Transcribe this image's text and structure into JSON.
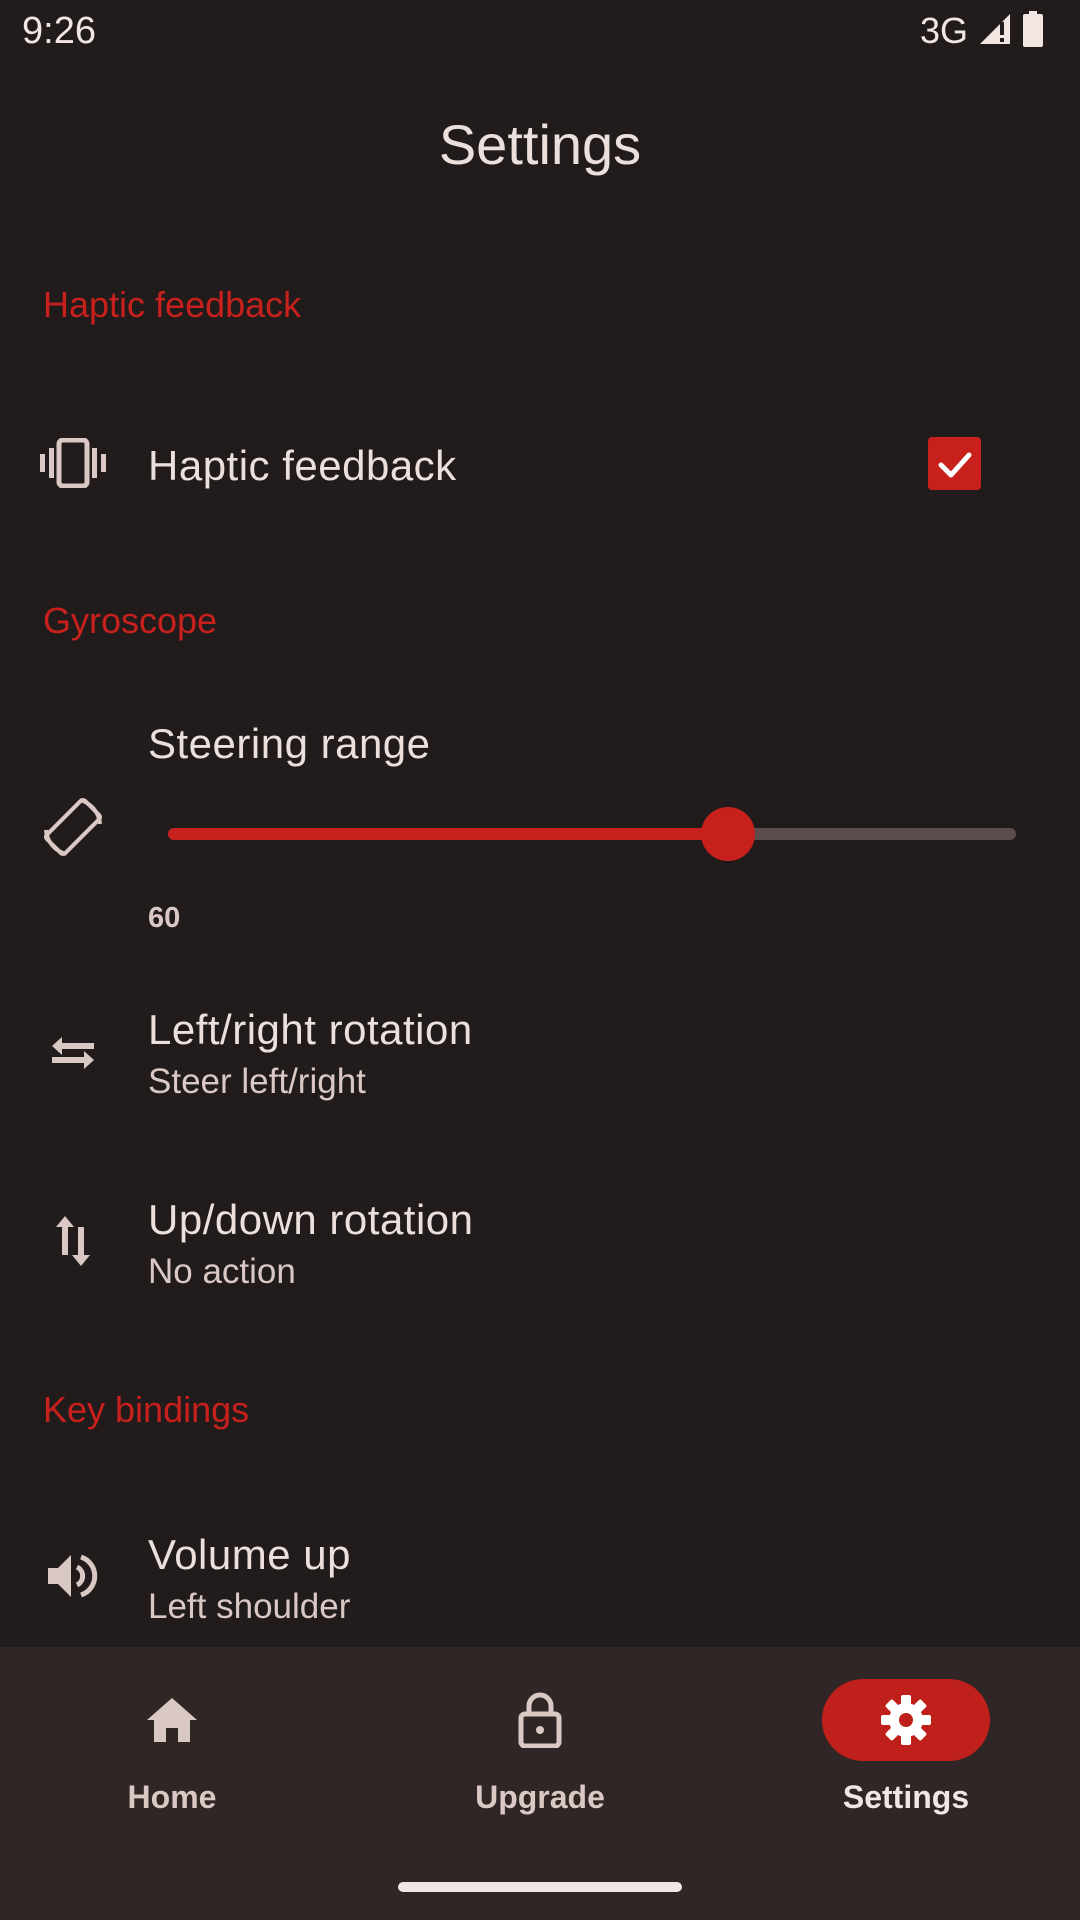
{
  "status": {
    "time": "9:26",
    "network": "3G"
  },
  "title": "Settings",
  "sections": {
    "haptic": {
      "header": "Haptic feedback",
      "item_title": "Haptic feedback",
      "checked": true
    },
    "gyroscope": {
      "header": "Gyroscope",
      "steering": {
        "title": "Steering range",
        "value": "60",
        "fraction": 0.66
      },
      "left_right": {
        "title": "Left/right rotation",
        "subtitle": "Steer left/right"
      },
      "up_down": {
        "title": "Up/down rotation",
        "subtitle": "No action"
      }
    },
    "key_bindings": {
      "header": "Key bindings",
      "volume_up": {
        "title": "Volume up",
        "subtitle": "Left shoulder"
      }
    }
  },
  "nav": {
    "home": "Home",
    "upgrade": "Upgrade",
    "settings": "Settings",
    "active": "settings"
  },
  "colors": {
    "accent": "#c8201c",
    "background": "#211c1b",
    "nav_background": "#302625"
  },
  "icons": [
    "vibration-icon",
    "screen-rotation-icon",
    "swap-horizontal-icon",
    "swap-vertical-icon",
    "volume-up-icon",
    "home-icon",
    "lock-icon",
    "gear-icon"
  ]
}
